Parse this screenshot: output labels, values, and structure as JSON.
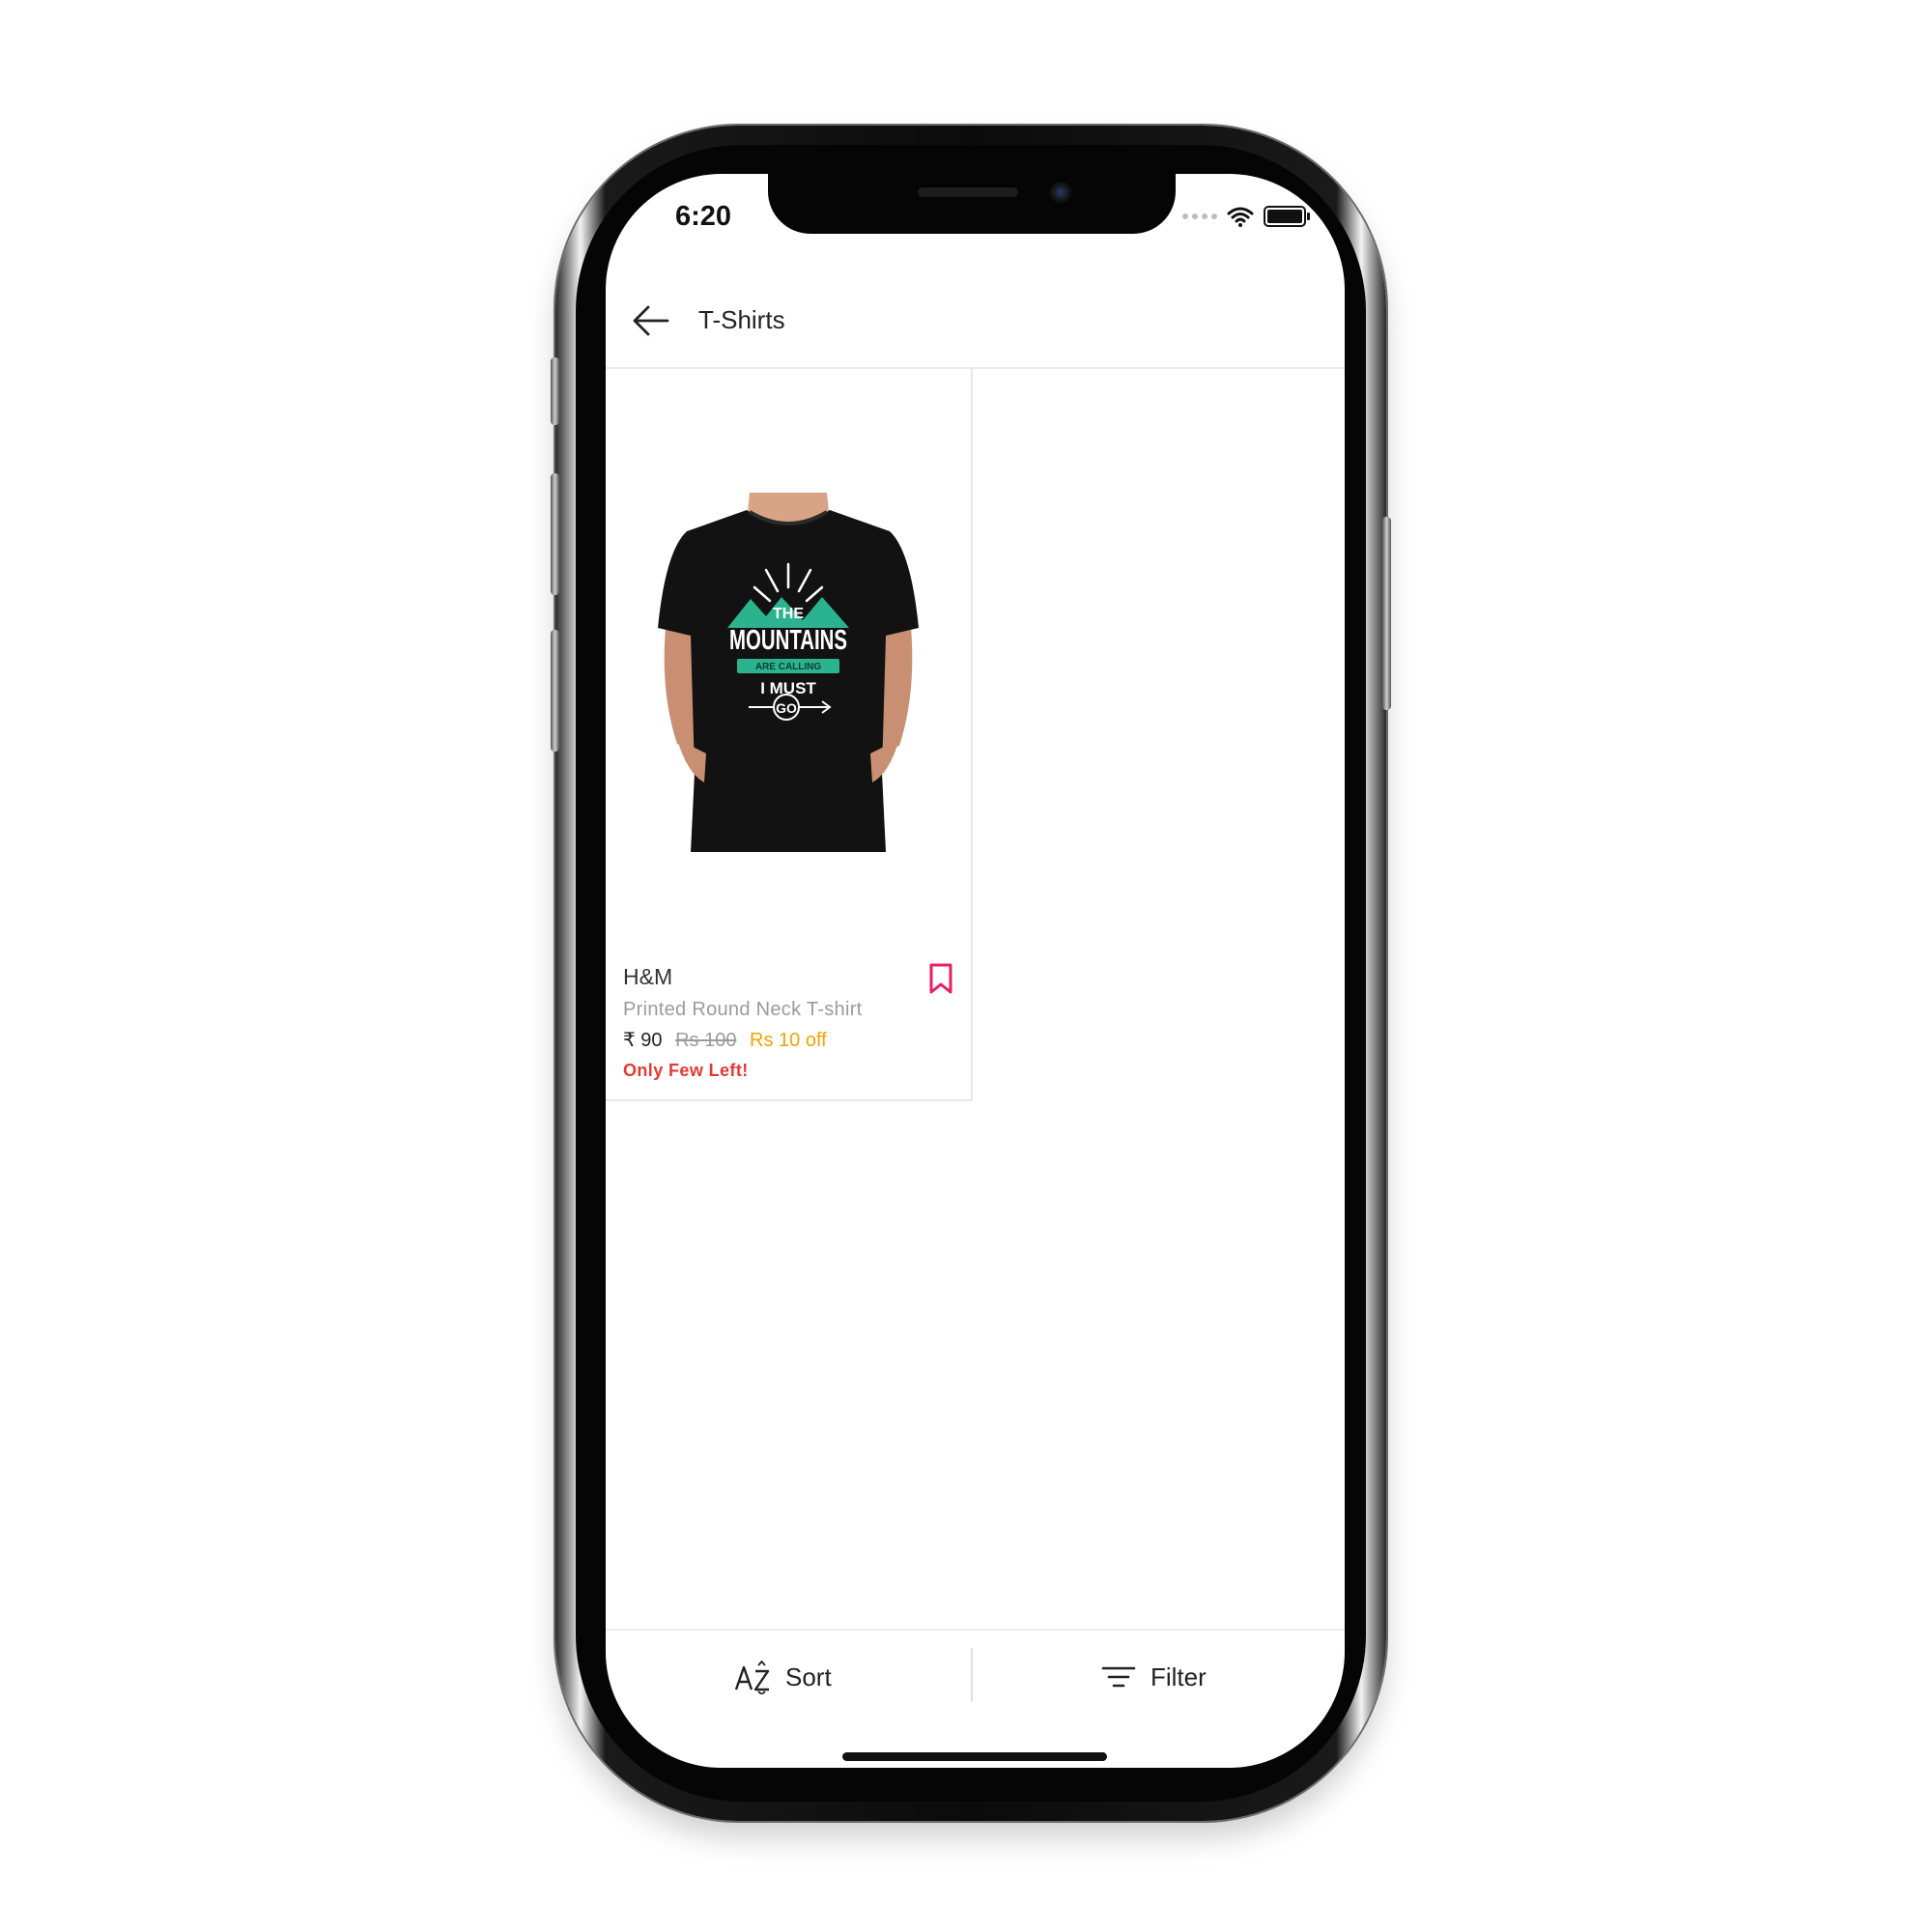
{
  "status_bar": {
    "time": "6:20"
  },
  "header": {
    "title": "T-Shirts",
    "back_icon": "arrow-left-icon"
  },
  "products": [
    {
      "brand": "H&M",
      "name": "Printed Round Neck T-shirt",
      "price": "₹ 90",
      "mrp": "Rs 100",
      "discount": "Rs 10 off",
      "stock_note": "Only Few Left!",
      "print_text": {
        "line1": "THE",
        "line2": "MOUNTAINS",
        "line3": "ARE CALLING",
        "line4": "I MUST",
        "line5": "GO"
      }
    }
  ],
  "bottom_bar": {
    "sort_label": "Sort",
    "filter_label": "Filter"
  },
  "colors": {
    "accent": "#e91e63",
    "discount": "#f0a500",
    "stock": "#e53935",
    "print_green": "#2bb38f"
  }
}
